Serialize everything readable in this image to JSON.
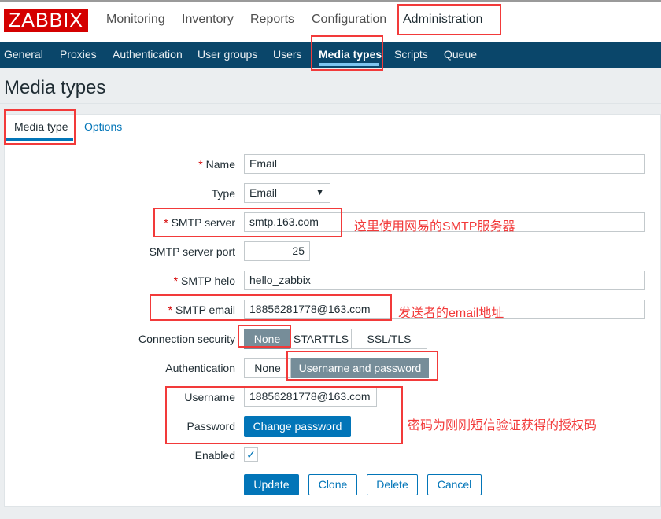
{
  "header": {
    "logo": "ZABBIX",
    "menu": [
      "Monitoring",
      "Inventory",
      "Reports",
      "Configuration",
      "Administration"
    ]
  },
  "subnav": [
    "General",
    "Proxies",
    "Authentication",
    "User groups",
    "Users",
    "Media types",
    "Scripts",
    "Queue"
  ],
  "page_title": "Media types",
  "tabs": [
    "Media type",
    "Options"
  ],
  "form": {
    "name_label": "Name",
    "name_value": "Email",
    "type_label": "Type",
    "type_value": "Email",
    "smtp_server_label": "SMTP server",
    "smtp_server_value": "smtp.163.com",
    "port_label": "SMTP server port",
    "port_value": "25",
    "helo_label": "SMTP helo",
    "helo_value": "hello_zabbix",
    "email_label": "SMTP email",
    "email_value": "18856281778@163.com",
    "security_label": "Connection security",
    "security_options": [
      "None",
      "STARTTLS",
      "SSL/TLS"
    ],
    "security_selected": "None",
    "auth_label": "Authentication",
    "auth_options": [
      "None",
      "Username and password"
    ],
    "auth_selected": "Username and password",
    "username_label": "Username",
    "username_value": "18856281778@163.com",
    "password_label": "Password",
    "change_password": "Change password",
    "enabled_label": "Enabled",
    "enabled": true,
    "required_mark": "*"
  },
  "buttons": [
    "Update",
    "Clone",
    "Delete",
    "Cancel"
  ],
  "annotations": [
    "这里使用网易的SMTP服务器",
    "发送者的email地址",
    "密码为刚刚短信验证获得的授权码"
  ],
  "colors": {
    "brand": "#d40000",
    "nav": "#0a466a",
    "primary": "#0275b8",
    "annotation": "#f23a3a"
  }
}
